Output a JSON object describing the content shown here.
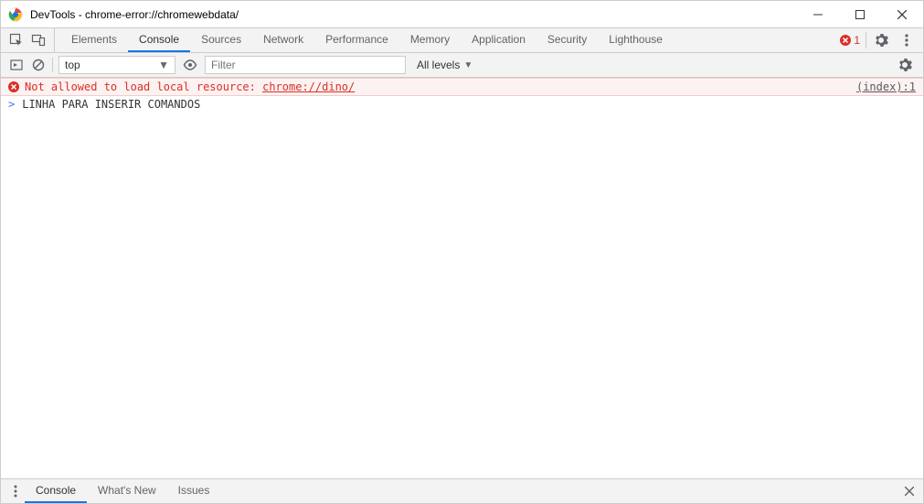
{
  "window": {
    "title": "DevTools - chrome-error://chromewebdata/"
  },
  "main_tabs": [
    "Elements",
    "Console",
    "Sources",
    "Network",
    "Performance",
    "Memory",
    "Application",
    "Security",
    "Lighthouse"
  ],
  "main_tabs_active": "Console",
  "error_count": "1",
  "toolbar": {
    "context": "top",
    "filter_placeholder": "Filter",
    "levels_label": "All levels"
  },
  "console": {
    "error_message": "Not allowed to load local resource: ",
    "error_resource_link": "chrome://dino/",
    "error_source": "(index):1",
    "input_line": "LINHA PARA INSERIR COMANDOS"
  },
  "drawer_tabs": [
    "Console",
    "What's New",
    "Issues"
  ],
  "drawer_active": "Console"
}
